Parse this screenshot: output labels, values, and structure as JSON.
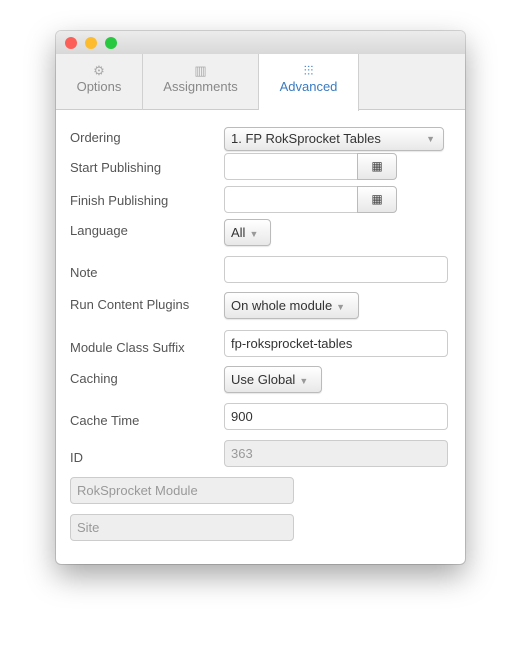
{
  "tabs": [
    {
      "label": "Options",
      "icon": "gear-icon"
    },
    {
      "label": "Assignments",
      "icon": "layout-icon"
    },
    {
      "label": "Advanced",
      "icon": "sliders-icon",
      "active": true
    }
  ],
  "form": {
    "ordering": {
      "label": "Ordering",
      "value": "1. FP RokSprocket Tables"
    },
    "start_publishing": {
      "label": "Start Publishing",
      "value": ""
    },
    "finish_publishing": {
      "label": "Finish Publishing",
      "value": ""
    },
    "language": {
      "label": "Language",
      "value": "All"
    },
    "note": {
      "label": "Note",
      "value": ""
    },
    "run_plugins": {
      "label": "Run Content Plugins",
      "value": "On whole module"
    },
    "class_suffix": {
      "label": "Module Class Suffix",
      "value": "fp-roksprocket-tables"
    },
    "caching": {
      "label": "Caching",
      "value": "Use Global"
    },
    "cache_time": {
      "label": "Cache Time",
      "value": "900"
    },
    "id": {
      "label": "ID",
      "value": "363"
    },
    "module_type": "RokSprocket Module",
    "client": "Site"
  },
  "colors": {
    "accent": "#3a7bc0",
    "close": "#fc5f57",
    "minimize": "#fdbc2e",
    "zoom": "#28c840"
  }
}
